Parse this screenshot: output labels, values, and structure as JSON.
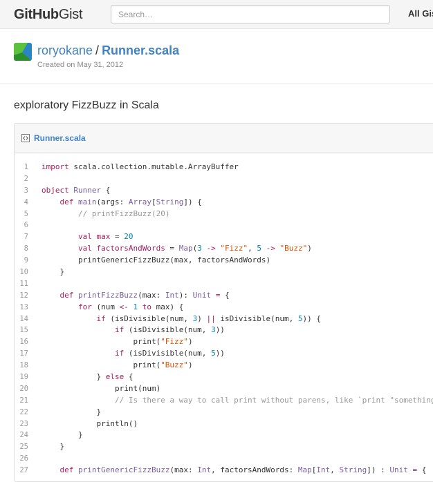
{
  "header": {
    "logo_brand": "GitHub",
    "logo_product": "Gist",
    "search_placeholder": "Search…",
    "nav_link": "All Gists"
  },
  "gist": {
    "owner": "roryokane",
    "separator": "/",
    "filename": "Runner.scala",
    "created": "Created on May 31, 2012",
    "description": "exploratory FizzBuzz in Scala"
  },
  "file": {
    "name": "Runner.scala",
    "icon": "code-file-icon"
  },
  "colors": {
    "link": "#4183c4",
    "keyword": "#a71d5d",
    "type": "#795da3",
    "number": "#0086b3",
    "string": "#df5000",
    "comment": "#969896"
  },
  "code_lines": [
    {
      "n": "1",
      "tokens": [
        [
          "kw",
          "import"
        ],
        [
          "p",
          " scala.collection.mutable.ArrayBuffer"
        ]
      ]
    },
    {
      "n": "2",
      "tokens": []
    },
    {
      "n": "3",
      "tokens": [
        [
          "kw",
          "object"
        ],
        [
          "p",
          " "
        ],
        [
          "ty",
          "Runner"
        ],
        [
          "p",
          " {"
        ]
      ]
    },
    {
      "n": "4",
      "tokens": [
        [
          "p",
          "    "
        ],
        [
          "kw",
          "def"
        ],
        [
          "p",
          " "
        ],
        [
          "ty",
          "main"
        ],
        [
          "p",
          "(args: "
        ],
        [
          "ty",
          "Array"
        ],
        [
          "p",
          "["
        ],
        [
          "ty",
          "String"
        ],
        [
          "p",
          "]) {"
        ]
      ]
    },
    {
      "n": "5",
      "tokens": [
        [
          "p",
          "        "
        ],
        [
          "cm",
          "// printFizzBuzz(20)"
        ]
      ]
    },
    {
      "n": "6",
      "tokens": []
    },
    {
      "n": "7",
      "tokens": [
        [
          "p",
          "        "
        ],
        [
          "kw",
          "val"
        ],
        [
          "p",
          " "
        ],
        [
          "kw",
          "max"
        ],
        [
          "p",
          " = "
        ],
        [
          "num",
          "20"
        ]
      ]
    },
    {
      "n": "8",
      "tokens": [
        [
          "p",
          "        "
        ],
        [
          "kw",
          "val"
        ],
        [
          "p",
          " "
        ],
        [
          "kw",
          "factorsAndWords"
        ],
        [
          "p",
          " = "
        ],
        [
          "ty",
          "Map"
        ],
        [
          "p",
          "("
        ],
        [
          "num",
          "3"
        ],
        [
          "p",
          " "
        ],
        [
          "kw",
          "->"
        ],
        [
          "p",
          " "
        ],
        [
          "str",
          "\"Fizz\""
        ],
        [
          "p",
          ", "
        ],
        [
          "num",
          "5"
        ],
        [
          "p",
          " "
        ],
        [
          "kw",
          "->"
        ],
        [
          "p",
          " "
        ],
        [
          "str",
          "\"Buzz\""
        ],
        [
          "p",
          ")"
        ]
      ]
    },
    {
      "n": "9",
      "tokens": [
        [
          "p",
          "        printGenericFizzBuzz(max, factorsAndWords)"
        ]
      ]
    },
    {
      "n": "10",
      "tokens": [
        [
          "p",
          "    }"
        ]
      ]
    },
    {
      "n": "11",
      "tokens": []
    },
    {
      "n": "12",
      "tokens": [
        [
          "p",
          "    "
        ],
        [
          "kw",
          "def"
        ],
        [
          "p",
          " "
        ],
        [
          "ty",
          "printFizzBuzz"
        ],
        [
          "p",
          "(max: "
        ],
        [
          "ty",
          "Int"
        ],
        [
          "p",
          "): "
        ],
        [
          "ty",
          "Unit"
        ],
        [
          "p",
          " "
        ],
        [
          "kw",
          "="
        ],
        [
          "p",
          " {"
        ]
      ]
    },
    {
      "n": "13",
      "tokens": [
        [
          "p",
          "        "
        ],
        [
          "kw",
          "for"
        ],
        [
          "p",
          " (num "
        ],
        [
          "kw",
          "<-"
        ],
        [
          "p",
          " "
        ],
        [
          "num",
          "1"
        ],
        [
          "p",
          " "
        ],
        [
          "kw",
          "to"
        ],
        [
          "p",
          " max) {"
        ]
      ]
    },
    {
      "n": "14",
      "tokens": [
        [
          "p",
          "            "
        ],
        [
          "kw",
          "if"
        ],
        [
          "p",
          " (isDivisible(num, "
        ],
        [
          "num",
          "3"
        ],
        [
          "p",
          ") "
        ],
        [
          "kw",
          "||"
        ],
        [
          "p",
          " isDivisible(num, "
        ],
        [
          "num",
          "5"
        ],
        [
          "p",
          ")) {"
        ]
      ]
    },
    {
      "n": "15",
      "tokens": [
        [
          "p",
          "                "
        ],
        [
          "kw",
          "if"
        ],
        [
          "p",
          " (isDivisible(num, "
        ],
        [
          "num",
          "3"
        ],
        [
          "p",
          "))"
        ]
      ]
    },
    {
      "n": "16",
      "tokens": [
        [
          "p",
          "                    print("
        ],
        [
          "str",
          "\"Fizz\""
        ],
        [
          "p",
          ")"
        ]
      ]
    },
    {
      "n": "17",
      "tokens": [
        [
          "p",
          "                "
        ],
        [
          "kw",
          "if"
        ],
        [
          "p",
          " (isDivisible(num, "
        ],
        [
          "num",
          "5"
        ],
        [
          "p",
          "))"
        ]
      ]
    },
    {
      "n": "18",
      "tokens": [
        [
          "p",
          "                    print("
        ],
        [
          "str",
          "\"Buzz\""
        ],
        [
          "p",
          ")"
        ]
      ]
    },
    {
      "n": "19",
      "tokens": [
        [
          "p",
          "            } "
        ],
        [
          "kw",
          "else"
        ],
        [
          "p",
          " {"
        ]
      ]
    },
    {
      "n": "20",
      "tokens": [
        [
          "p",
          "                print(num)"
        ]
      ]
    },
    {
      "n": "21",
      "tokens": [
        [
          "p",
          "                "
        ],
        [
          "cm",
          "// Is there a way to call print without parens, like `print \"something"
        ]
      ]
    },
    {
      "n": "22",
      "tokens": [
        [
          "p",
          "            }"
        ]
      ]
    },
    {
      "n": "23",
      "tokens": [
        [
          "p",
          "            println()"
        ]
      ]
    },
    {
      "n": "24",
      "tokens": [
        [
          "p",
          "        }"
        ]
      ]
    },
    {
      "n": "25",
      "tokens": [
        [
          "p",
          "    }"
        ]
      ]
    },
    {
      "n": "26",
      "tokens": []
    },
    {
      "n": "27",
      "tokens": [
        [
          "p",
          "    "
        ],
        [
          "kw",
          "def"
        ],
        [
          "p",
          " "
        ],
        [
          "ty",
          "printGenericFizzBuzz"
        ],
        [
          "p",
          "(max: "
        ],
        [
          "ty",
          "Int"
        ],
        [
          "p",
          ", factorsAndWords: "
        ],
        [
          "ty",
          "Map"
        ],
        [
          "p",
          "["
        ],
        [
          "ty",
          "Int"
        ],
        [
          "p",
          ", "
        ],
        [
          "ty",
          "String"
        ],
        [
          "p",
          "]) : "
        ],
        [
          "ty",
          "Unit"
        ],
        [
          "p",
          " "
        ],
        [
          "kw",
          "="
        ],
        [
          "p",
          " {"
        ]
      ]
    }
  ]
}
